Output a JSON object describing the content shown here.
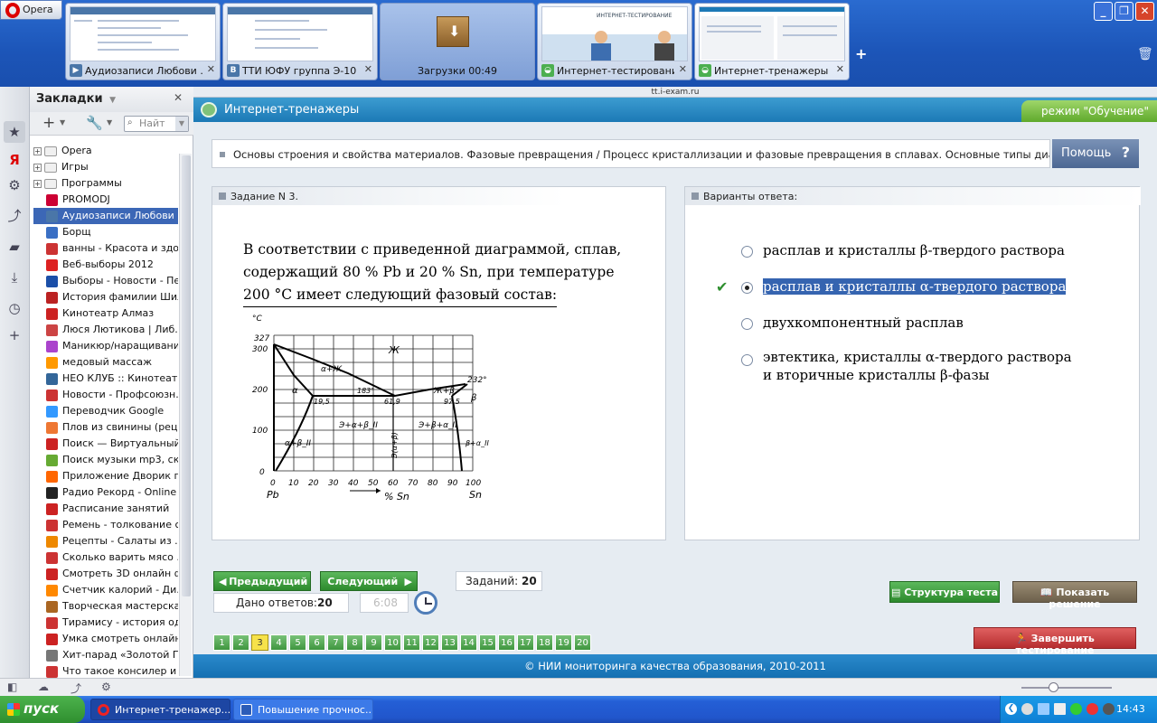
{
  "browser": {
    "menu_label": "Opera",
    "address": "tt.i-exam.ru",
    "tabs": [
      {
        "title": "Аудиозаписи Любови ...",
        "icon": "vk-icon"
      },
      {
        "title": "ТТИ ЮФУ группа Э-10",
        "icon": "vk-icon"
      },
      {
        "title": "Загрузки 00:49",
        "icon": "downloads-box-icon"
      },
      {
        "title": "Интернет-тестирование",
        "icon": "i-exam-icon"
      },
      {
        "title": "Интернет-тренажеры",
        "icon": "i-exam-icon"
      }
    ],
    "thumb_heading": "ИНТЕРНЕТ-ТЕСТИРОВАНИЕ"
  },
  "bookmarks": {
    "title": "Закладки",
    "search_placeholder": "Найт",
    "items": [
      {
        "label": "Opera",
        "type": "folder"
      },
      {
        "label": "Игры",
        "type": "folder"
      },
      {
        "label": "Программы",
        "type": "folder"
      },
      {
        "label": "PROMODJ",
        "color": "#c03"
      },
      {
        "label": "Аудиозаписи Любови ...",
        "color": "#4a76a8",
        "selected": true
      },
      {
        "label": "Борщ",
        "color": "#3a6fc4"
      },
      {
        "label": "ванны - Красота и здо...",
        "color": "#c33"
      },
      {
        "label": "Веб-выборы 2012",
        "color": "#d22"
      },
      {
        "label": "Выборы - Новости - Пе...",
        "color": "#1b4fa8"
      },
      {
        "label": "История фамилии Шил...",
        "color": "#b22"
      },
      {
        "label": "Кинотеатр Алмаз",
        "color": "#c22"
      },
      {
        "label": "Люся Лютикова | Либ...",
        "color": "#c44"
      },
      {
        "label": "Маникюр/наращивани...",
        "color": "#a4c"
      },
      {
        "label": "медовый массаж",
        "color": "#f90"
      },
      {
        "label": "НЕО КЛУБ :: Кинотеатр",
        "color": "#369"
      },
      {
        "label": "Новости - Профсоюзн...",
        "color": "#c33"
      },
      {
        "label": "Переводчик Google",
        "color": "#39f"
      },
      {
        "label": "Плов из свинины (рец...",
        "color": "#e73"
      },
      {
        "label": "Поиск — Виртуальный...",
        "color": "#c22"
      },
      {
        "label": "Поиск музыки mp3, ск...",
        "color": "#6a3"
      },
      {
        "label": "Приложение Дворик п...",
        "color": "#f60"
      },
      {
        "label": "Радио Рекорд - Online ...",
        "color": "#222"
      },
      {
        "label": "Расписание занятий",
        "color": "#c22"
      },
      {
        "label": "Ремень - толкование с...",
        "color": "#c33"
      },
      {
        "label": "Рецепты - Салаты из ...",
        "color": "#e80"
      },
      {
        "label": "Сколько варить мясо ...",
        "color": "#c33"
      },
      {
        "label": "Смотреть 3D онлайн ф...",
        "color": "#c22"
      },
      {
        "label": "Счетчик калорий - Ди...",
        "color": "#f80"
      },
      {
        "label": "Творческая мастерска...",
        "color": "#a62"
      },
      {
        "label": "Тирамису - история од...",
        "color": "#c33"
      },
      {
        "label": "Умка смотреть онлайн...",
        "color": "#c22"
      },
      {
        "label": "Хит-парад «Золотой Г...",
        "color": "#777"
      },
      {
        "label": "Что такое консилер и ...",
        "color": "#c33"
      }
    ]
  },
  "app": {
    "title": "Интернет-тренажеры",
    "mode": "режим \"Обучение\"",
    "breadcrumb": "Основы строения и свойства материалов. Фазовые превращения / Процесс кристаллизации и фазовые превращения в сплавах. Основные типы диаграмм ...",
    "help_label": "Помощь",
    "help_icon": "?"
  },
  "task": {
    "header": "Задание N 3.",
    "text_lines": [
      "В соответствии с приведенной диаграммой, сплав,",
      "содержащий 80 % Pb и 20 % Sn, при температуре",
      "200 °C имеет следующий фазовый состав:"
    ],
    "diagram": {
      "y_unit": "°C",
      "y_ticks": [
        "300",
        "200",
        "100",
        "0"
      ],
      "x_ticks": [
        "0",
        "10",
        "20",
        "30",
        "40",
        "50",
        "60",
        "70",
        "80",
        "90",
        "100"
      ],
      "x_left_label": "Pb",
      "x_right_label": "Sn",
      "x_axis_label": "% Sn",
      "annotations": [
        "327",
        "232°",
        "183°",
        "19,5",
        "61,9",
        "97,5",
        "Ж",
        "α+Ж",
        "Ж+β",
        "α",
        "β",
        "α+β_II",
        "Э+α+β_II",
        "Э+β+α_II",
        "Э(α+β)",
        "β+α_II"
      ]
    }
  },
  "answers": {
    "header": "Варианты ответа:",
    "options": [
      {
        "text": "расплав и кристаллы β-твердого раствора",
        "selected": false
      },
      {
        "text": "расплав и кристаллы α-твердого раствора",
        "selected": true
      },
      {
        "text": "двухкомпонентный расплав",
        "selected": false
      },
      {
        "text": "эвтектика, кристаллы α-твердого раствора",
        "text2": "и вторичные кристаллы β-фазы",
        "selected": false
      }
    ]
  },
  "nav": {
    "prev_label": "Предыдущий",
    "next_label": "Следующий",
    "tasks_label": "Заданий:",
    "tasks_count": "20",
    "answered_label": "Дано ответов:",
    "answered_count": "20",
    "timer": "6:08",
    "structure_label": "Структура теста",
    "solution_label": "Показать решение",
    "finish_label": "Завершить тестирование",
    "pages": [
      "1",
      "2",
      "3",
      "4",
      "5",
      "6",
      "7",
      "8",
      "9",
      "10",
      "11",
      "12",
      "13",
      "14",
      "15",
      "16",
      "17",
      "18",
      "19",
      "20"
    ],
    "current_page": "3"
  },
  "footer": "© НИИ мониторинга качества образования, 2010-2011",
  "taskbar": {
    "start_label": "пуск",
    "tasks": [
      "Интернет-тренажер...",
      "Повышение прочнос..."
    ],
    "clock": "14:43"
  },
  "colors": {
    "accent_blue": "#1c79b6",
    "button_green": "#2d8a2d",
    "highlight": "#3564b0",
    "finish_red": "#c0393b"
  }
}
